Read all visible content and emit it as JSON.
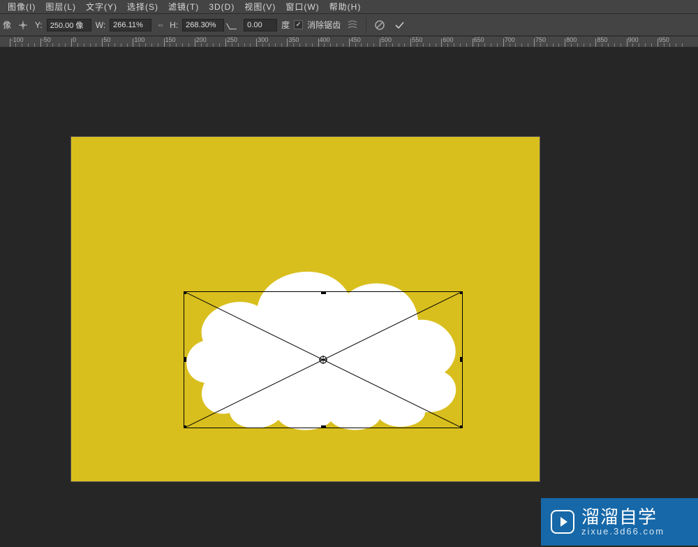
{
  "menu": {
    "items": [
      "图像(I)",
      "图层(L)",
      "文字(Y)",
      "选择(S)",
      "滤镜(T)",
      "3D(D)",
      "视图(V)",
      "窗口(W)",
      "帮助(H)"
    ]
  },
  "options": {
    "y_label": "Y:",
    "y_value": "250.00 像",
    "w_label": "W:",
    "w_value": "266.11%",
    "h_label": "H:",
    "h_value": "268.30%",
    "rot_value": "0.00",
    "rot_suffix": "度",
    "antialias_label": "消除锯齿",
    "antialias_checked": "✓",
    "partial_prefix": "像"
  },
  "ruler": {
    "start": -100,
    "step": 50,
    "count": 22
  },
  "watermark": {
    "title": "溜溜自学",
    "sub": "zixue.3d66.com"
  }
}
